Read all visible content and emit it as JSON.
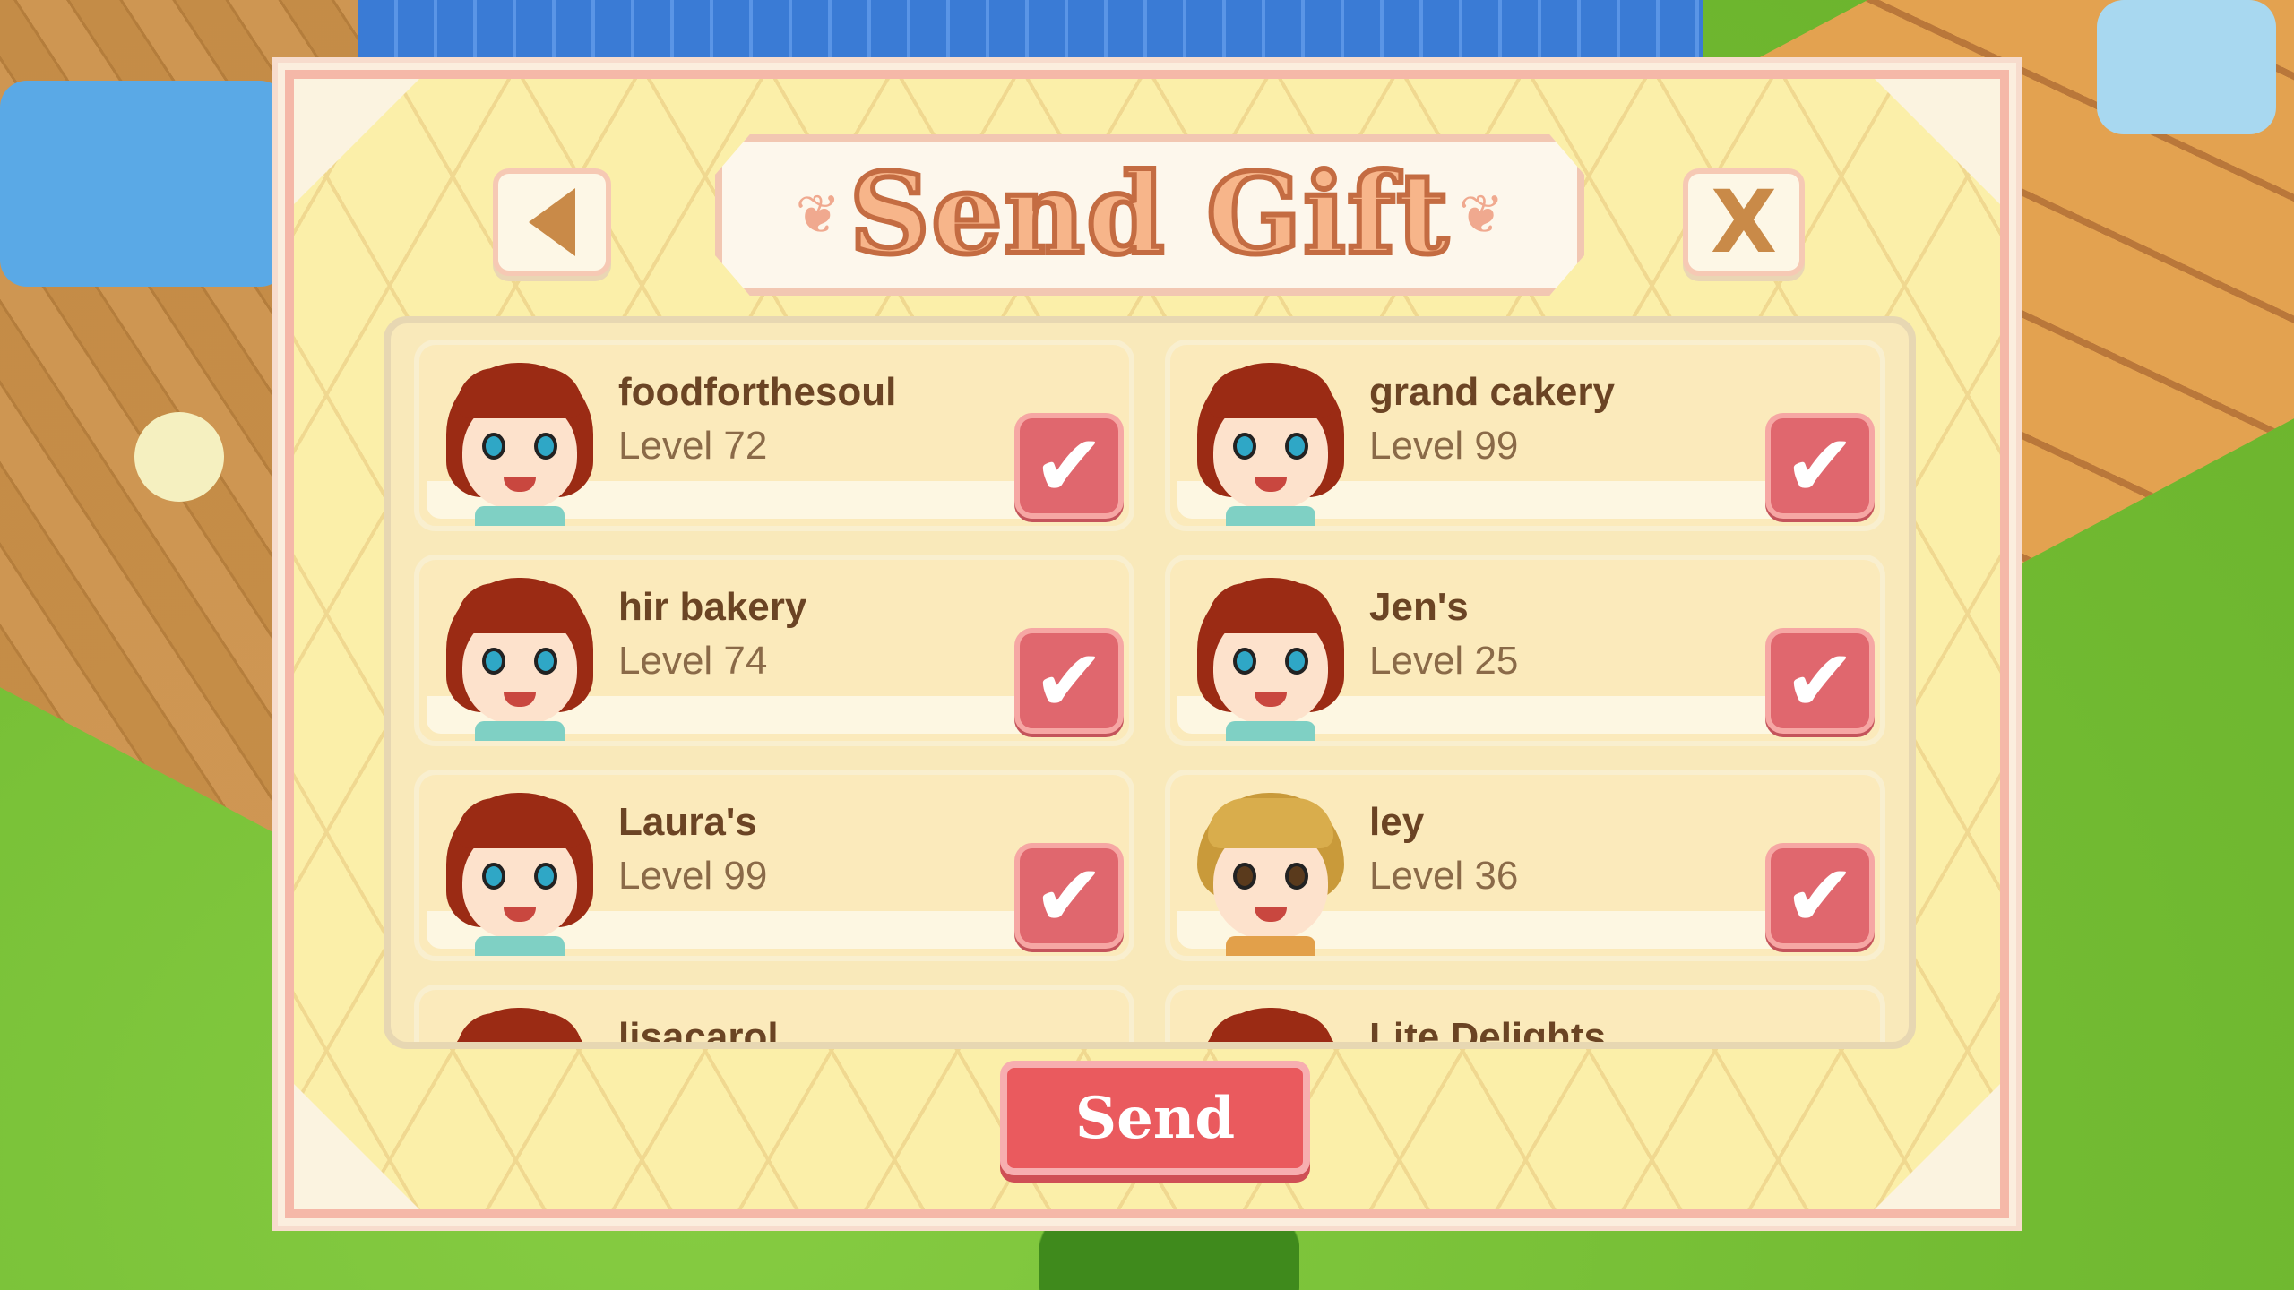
{
  "dialog": {
    "title": "Send Gift",
    "close_label": "X",
    "send_label": "Send",
    "check_glyph": "✔"
  },
  "friends": [
    {
      "name": "foodforthesoul",
      "level": "Level 72",
      "avatar": "female-chef-avatar",
      "checked": true
    },
    {
      "name": "grand cakery",
      "level": "Level 99",
      "avatar": "female-chef-avatar",
      "checked": true
    },
    {
      "name": "hir bakery",
      "level": "Level 74",
      "avatar": "female-chef-avatar",
      "checked": true
    },
    {
      "name": "Jen's",
      "level": "Level 25",
      "avatar": "female-chef-avatar",
      "checked": true
    },
    {
      "name": "Laura's",
      "level": "Level 99",
      "avatar": "female-chef-avatar",
      "checked": true
    },
    {
      "name": "ley",
      "level": "Level 36",
      "avatar": "male-chef-avatar",
      "checked": true
    },
    {
      "name": "lisacarol",
      "level": "",
      "avatar": "female-chef-avatar",
      "checked": true
    },
    {
      "name": "Lite Delights",
      "level": "",
      "avatar": "female-chef-avatar",
      "checked": true
    }
  ],
  "colors": {
    "dialog_bg": "#fbefa9",
    "dialog_border": "#f5b8a8",
    "checkbox": "#e0676e",
    "send_button": "#ea5a5e",
    "name_text": "#6b4424",
    "title_fill": "#f7b58a",
    "title_stroke": "#c46c42"
  },
  "icons": {
    "back": "back-arrow-icon",
    "close": "close-icon",
    "check": "checkmark-icon"
  }
}
